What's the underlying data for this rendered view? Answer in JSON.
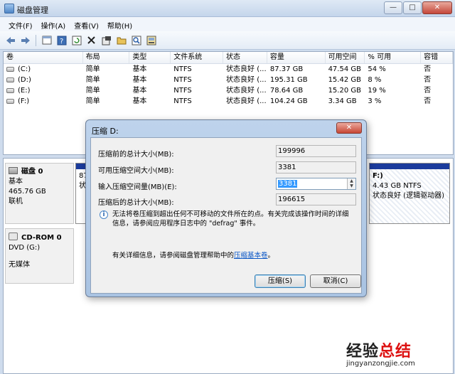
{
  "window": {
    "title": "磁盘管理"
  },
  "window_buttons": {
    "min": "—",
    "max": "□",
    "close": "✕"
  },
  "menu": [
    "文件(F)",
    "操作(A)",
    "查看(V)",
    "帮助(H)"
  ],
  "toolbar": {
    "icons": [
      "back-icon",
      "forward-icon",
      "properties-icon",
      "help-icon",
      "refresh-icon",
      "delete-icon",
      "settings-icon",
      "open-icon",
      "search-icon",
      "rescan-icon"
    ]
  },
  "volume_list": {
    "columns": [
      "卷",
      "布局",
      "类型",
      "文件系统",
      "状态",
      "容量",
      "可用空间",
      "% 可用",
      "容错"
    ],
    "rows": [
      {
        "vol": "(C:)",
        "layout": "简单",
        "type": "基本",
        "fs": "NTFS",
        "status": "状态良好 (...",
        "capacity": "87.37 GB",
        "free": "47.54 GB",
        "pct": "54 %",
        "ft": "否"
      },
      {
        "vol": "(D:)",
        "layout": "简单",
        "type": "基本",
        "fs": "NTFS",
        "status": "状态良好 (...",
        "capacity": "195.31 GB",
        "free": "15.42 GB",
        "pct": "8 %",
        "ft": "否"
      },
      {
        "vol": "(E:)",
        "layout": "简单",
        "type": "基本",
        "fs": "NTFS",
        "status": "状态良好 (...",
        "capacity": "78.64 GB",
        "free": "15.20 GB",
        "pct": "19 %",
        "ft": "否"
      },
      {
        "vol": "(F:)",
        "layout": "简单",
        "type": "基本",
        "fs": "NTFS",
        "status": "状态良好 (...",
        "capacity": "104.24 GB",
        "free": "3.34 GB",
        "pct": "3 %",
        "ft": "否"
      }
    ]
  },
  "disks": {
    "disk0": {
      "name": "磁盘 0",
      "type": "基本",
      "size": "465.76 GB",
      "status": "联机",
      "partial_left": "87",
      "partial_left2": "状"
    },
    "cdrom0": {
      "name": "CD-ROM 0",
      "drive": "DVD (G:)",
      "media": "无媒体"
    },
    "partition_f": {
      "label": "F:)",
      "size": "4.43 GB NTFS",
      "status": "状态良好 (逻辑驱动器)"
    }
  },
  "dialog": {
    "title": "压缩 D:",
    "close": "✕",
    "fields": [
      {
        "label": "压缩前的总计大小(MB):",
        "value": "199996"
      },
      {
        "label": "可用压缩空间大小(MB):",
        "value": "3381"
      },
      {
        "label": "输入压缩空间量(MB)(E):",
        "value": "3381"
      },
      {
        "label": "压缩后的总计大小(MB):",
        "value": "196615"
      }
    ],
    "info_icon": "i",
    "info": "无法将卷压缩到超出任何不可移动的文件所在的点。有关完成该操作时间的详细信息，请参阅应用程序日志中的 \"defrag\" 事件。",
    "help_prefix": "有关详细信息，请参阅磁盘管理帮助中的",
    "help_link": "压缩基本卷",
    "help_suffix": "。",
    "ok": "压缩(S)",
    "cancel": "取消(C)"
  },
  "watermark": {
    "main_a": "经验",
    "main_b": "总结",
    "sub": "jingyanzongjie.com"
  }
}
